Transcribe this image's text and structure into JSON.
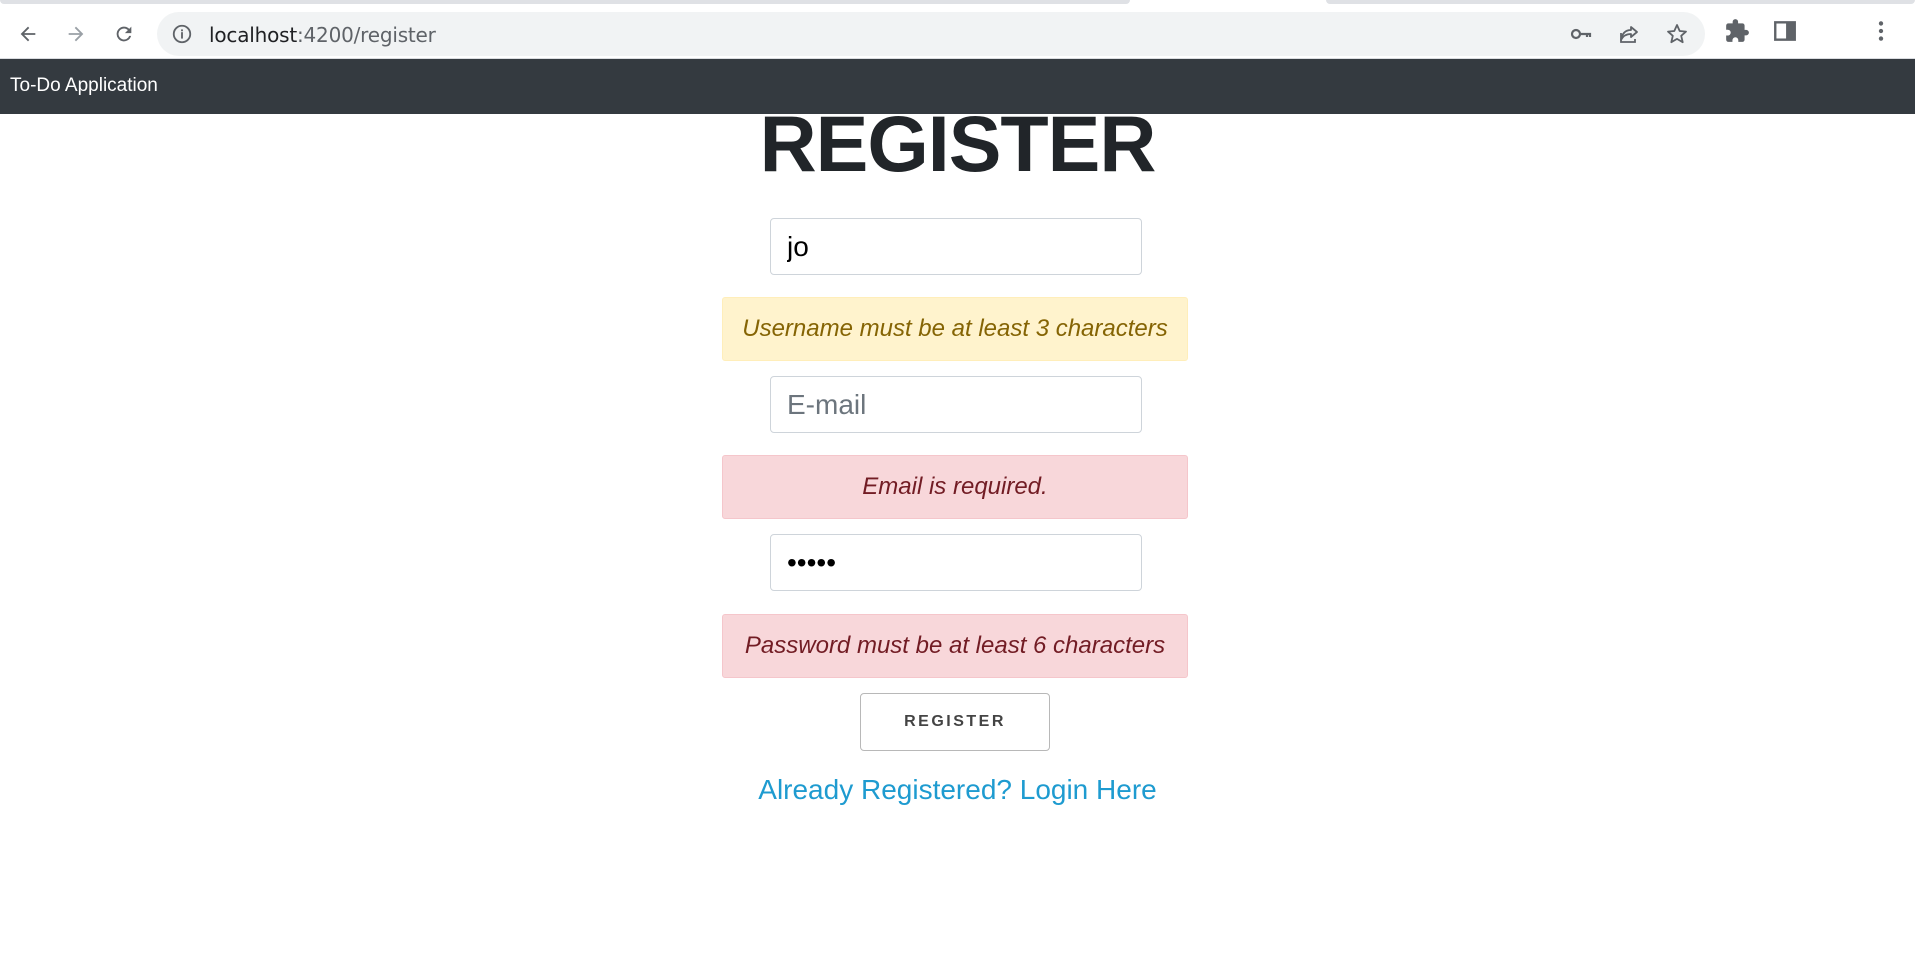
{
  "browser": {
    "url_host": "localhost",
    "url_path": ":4200/register"
  },
  "app": {
    "brand": "To-Do Application"
  },
  "form": {
    "title": "REGISTER",
    "username_value": "jo",
    "username_error": "Username must be at least 3 characters",
    "email_placeholder": "E-mail",
    "email_error": "Email is required.",
    "password_value": "•••••",
    "password_error": "Password must be at least 6 characters",
    "submit_label": "REGISTER",
    "login_link": "Already Registered? Login Here"
  },
  "colors": {
    "appbar": "#343a40",
    "warning_bg": "#fff3cd",
    "warning_text": "#856404",
    "error_bg": "#f8d7da",
    "error_text": "#721c24",
    "link": "#1e9bd0"
  }
}
